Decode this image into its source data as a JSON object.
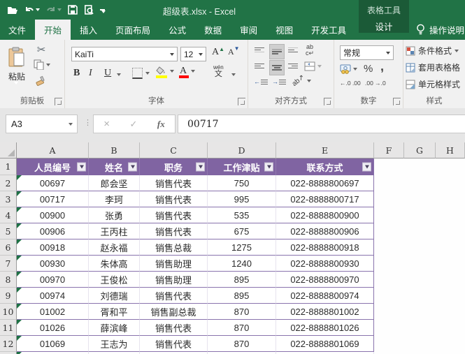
{
  "titlebar": {
    "title": "超级表.xlsx - Excel",
    "context_tool": "表格工具",
    "qat": [
      "open",
      "undo",
      "redo",
      "save",
      "print-preview",
      "customize-quick-access"
    ]
  },
  "tabs": [
    {
      "label": "文件"
    },
    {
      "label": "开始"
    },
    {
      "label": "插入"
    },
    {
      "label": "页面布局"
    },
    {
      "label": "公式"
    },
    {
      "label": "数据"
    },
    {
      "label": "审阅"
    },
    {
      "label": "视图"
    },
    {
      "label": "开发工具"
    },
    {
      "label": "设计"
    }
  ],
  "tellme": {
    "label": "操作说明"
  },
  "ribbon": {
    "clipboard": {
      "paste_label": "粘贴",
      "group_label": "剪贴板"
    },
    "font": {
      "name": "KaiTi",
      "size": "12",
      "bold": "B",
      "italic": "I",
      "underline": "U",
      "grow": "A",
      "shrink": "A",
      "phonetic_top": "wén",
      "phonetic_bottom": "文",
      "color_letter": "A",
      "group_label": "字体",
      "fill_color": "#ffff00",
      "font_color": "#ff0000"
    },
    "alignment": {
      "group_label": "对齐方式"
    },
    "number": {
      "format": "常规",
      "percent": "%",
      "comma": ",",
      "inc_decimal": "←.0 .00",
      "dec_decimal": ".00 →.0",
      "group_label": "数字"
    },
    "styles": {
      "items": [
        "条件格式",
        "套用表格格",
        "单元格样式"
      ],
      "group_label": "样式"
    }
  },
  "formula_bar": {
    "name_box": "A3",
    "cancel": "×",
    "enter": "✓",
    "fx_label": "fx",
    "value": "00717"
  },
  "grid": {
    "col_letters": [
      "A",
      "B",
      "C",
      "D",
      "E",
      "F",
      "G",
      "H"
    ],
    "table": {
      "headers": [
        "人员编号",
        "姓名",
        "职务",
        "工作津贴",
        "联系方式"
      ],
      "rows": [
        {
          "n": "2",
          "id": "00697",
          "name": "郎会坚",
          "title": "销售代表",
          "allowance": "750",
          "phone": "022-8888800697"
        },
        {
          "n": "3",
          "id": "00717",
          "name": "李珂",
          "title": "销售代表",
          "allowance": "995",
          "phone": "022-8888800717"
        },
        {
          "n": "4",
          "id": "00900",
          "name": "张勇",
          "title": "销售代表",
          "allowance": "535",
          "phone": "022-8888800900"
        },
        {
          "n": "5",
          "id": "00906",
          "name": "王丙柱",
          "title": "销售代表",
          "allowance": "675",
          "phone": "022-8888800906"
        },
        {
          "n": "6",
          "id": "00918",
          "name": "赵永福",
          "title": "销售总裁",
          "allowance": "1275",
          "phone": "022-8888800918"
        },
        {
          "n": "7",
          "id": "00930",
          "name": "朱体高",
          "title": "销售助理",
          "allowance": "1240",
          "phone": "022-8888800930"
        },
        {
          "n": "8",
          "id": "00970",
          "name": "王俊松",
          "title": "销售助理",
          "allowance": "895",
          "phone": "022-8888800970"
        },
        {
          "n": "9",
          "id": "00974",
          "name": "刘德瑞",
          "title": "销售代表",
          "allowance": "895",
          "phone": "022-8888800974"
        },
        {
          "n": "10",
          "id": "01002",
          "name": "胥和平",
          "title": "销售副总裁",
          "allowance": "870",
          "phone": "022-8888801002"
        },
        {
          "n": "11",
          "id": "01026",
          "name": "薛滨峰",
          "title": "销售代表",
          "allowance": "870",
          "phone": "022-8888801026"
        },
        {
          "n": "12",
          "id": "01069",
          "name": "王志为",
          "title": "销售代表",
          "allowance": "870",
          "phone": "022-8888801069"
        }
      ]
    }
  },
  "colors": {
    "excel_green": "#217346",
    "contextual_green": "#1b5a37",
    "table_header_purple": "#8064A2",
    "table_row_line_purple": "#8973ad",
    "error_triangle_green": "#1e7145",
    "ribbon_bg": "#f1f1f1",
    "formula_bar_bg": "#e6e6e6"
  }
}
